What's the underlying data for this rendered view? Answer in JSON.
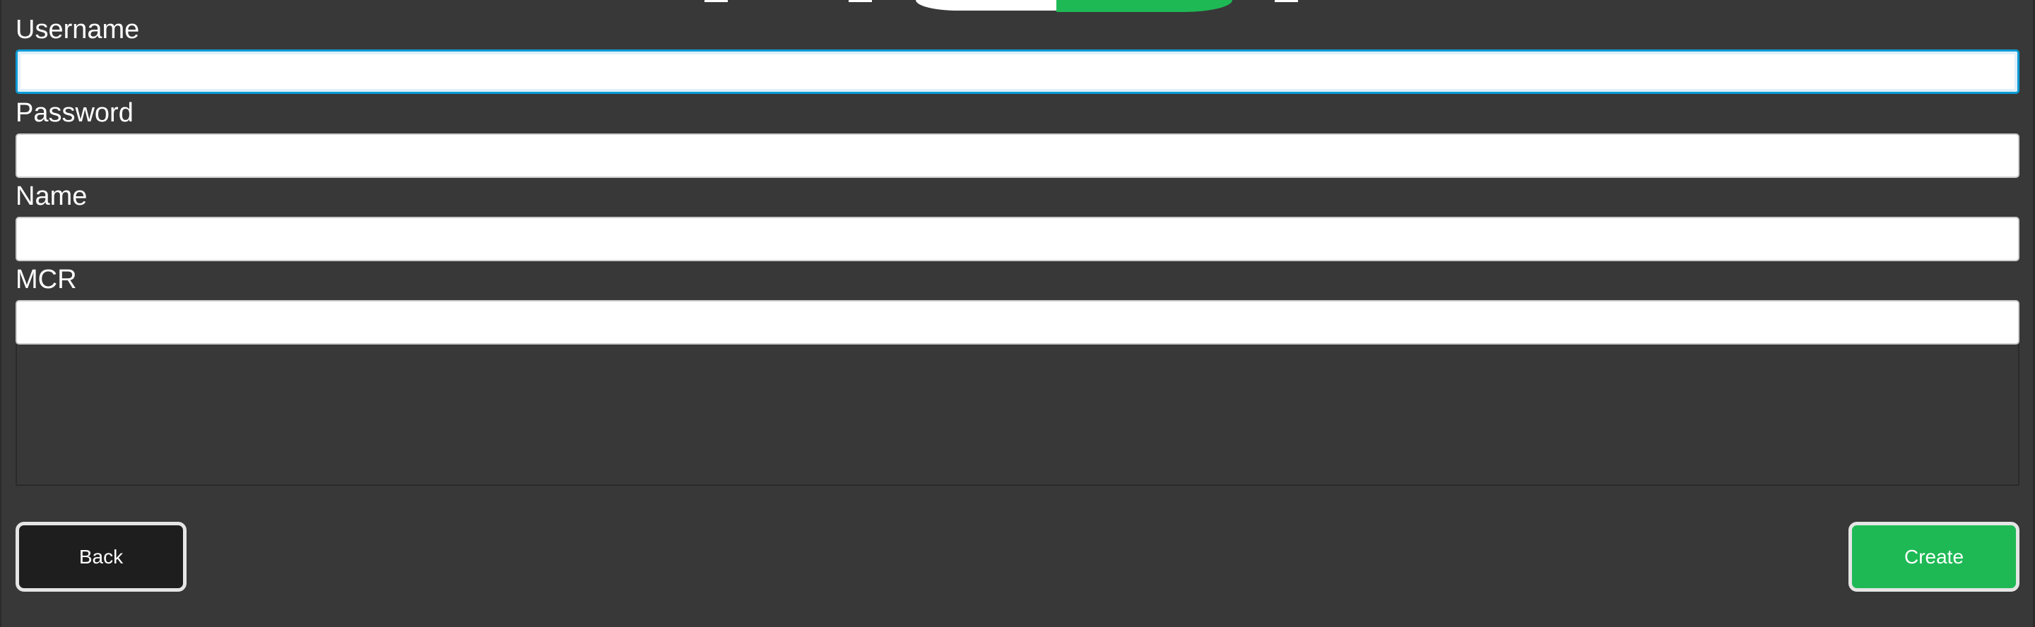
{
  "form": {
    "fields": [
      {
        "label": "Username",
        "value": "",
        "focused": true
      },
      {
        "label": "Password",
        "value": ""
      },
      {
        "label": "Name",
        "value": ""
      },
      {
        "label": "MCR",
        "value": ""
      }
    ]
  },
  "buttons": {
    "back_label": "Back",
    "create_label": "Create"
  },
  "colors": {
    "background": "#383838",
    "accent_green": "#1eb955",
    "focus_blue": "#0a9bd6"
  }
}
